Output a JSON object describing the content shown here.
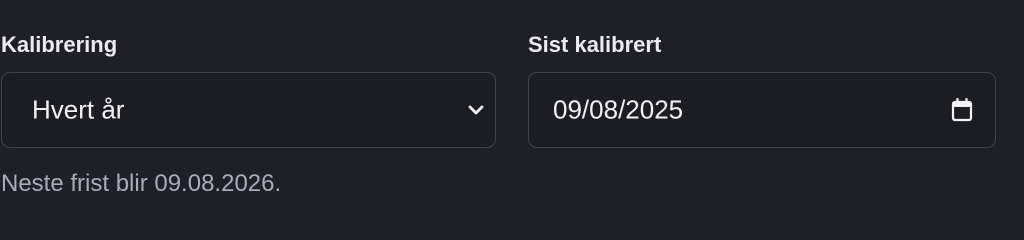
{
  "form": {
    "calibration": {
      "label": "Kalibrering",
      "selected_value": "Hvert år"
    },
    "last_calibrated": {
      "label": "Sist kalibrert",
      "value": "09/08/2025"
    },
    "hint": "Neste frist blir 09.08.2026."
  },
  "icons": {
    "dropdown": "chevron-down-icon",
    "date_picker": "calendar-icon"
  },
  "colors": {
    "background": "#1f2027",
    "input_background": "#1c1d23",
    "border": "#41424b",
    "label_text": "#ececf0",
    "value_text": "#f2f2f5",
    "hint_text": "#a9abb6"
  }
}
